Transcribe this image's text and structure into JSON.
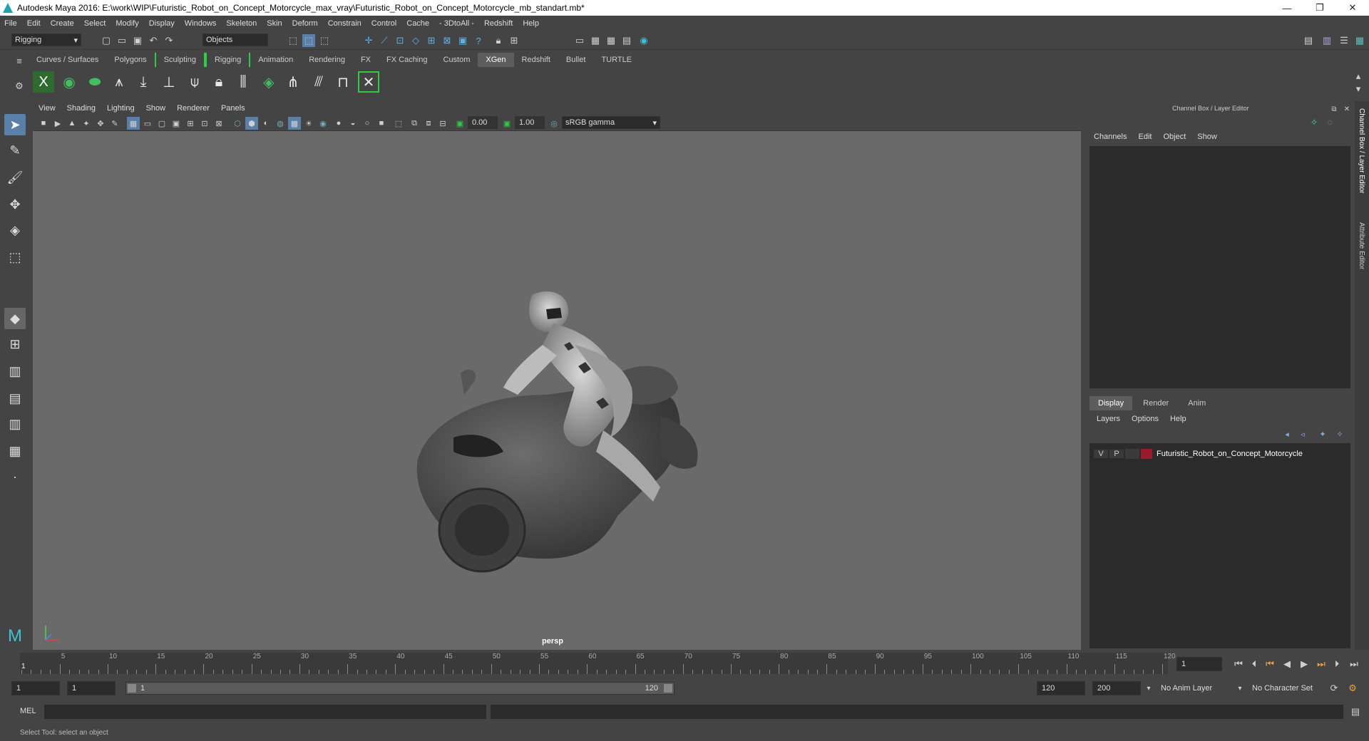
{
  "app": {
    "title": "Autodesk Maya 2016: E:\\work\\WIP\\Futuristic_Robot_on_Concept_Motorcycle_max_vray\\Futuristic_Robot_on_Concept_Motorcycle_mb_standart.mb*",
    "window_buttons": [
      "—",
      "❐",
      "✕"
    ]
  },
  "menubar": [
    "File",
    "Edit",
    "Create",
    "Select",
    "Modify",
    "Display",
    "Windows",
    "Skeleton",
    "Skin",
    "Deform",
    "Constrain",
    "Control",
    "Cache",
    "- 3DtoAll -",
    "Redshift",
    "Help"
  ],
  "statusline": {
    "menuset": "Rigging",
    "selection_mode": "Objects"
  },
  "shelf": {
    "tabs": [
      "Curves / Surfaces",
      "Polygons",
      "Sculpting",
      "Rigging",
      "Animation",
      "Rendering",
      "FX",
      "FX Caching",
      "Custom",
      "XGen",
      "Redshift",
      "Bullet",
      "TURTLE"
    ],
    "active_tab": "XGen"
  },
  "viewport": {
    "menu": [
      "View",
      "Shading",
      "Lighting",
      "Show",
      "Renderer",
      "Panels"
    ],
    "exposure": "0.00",
    "gamma": "1.00",
    "color_space": "sRGB gamma",
    "camera_label": "persp"
  },
  "channel_box": {
    "title": "Channel Box / Layer Editor",
    "menu": [
      "Channels",
      "Edit",
      "Object",
      "Show"
    ]
  },
  "layer_editor": {
    "tabs": [
      "Display",
      "Render",
      "Anim"
    ],
    "active_tab": "Display",
    "menu": [
      "Layers",
      "Options",
      "Help"
    ],
    "layers": [
      {
        "v": "V",
        "p": "P",
        "color": "#9b1b2e",
        "name": "Futuristic_Robot_on_Concept_Motorcycle"
      }
    ]
  },
  "side_tabs": [
    "Channel Box / Layer Editor",
    "Attribute Editor"
  ],
  "timeline": {
    "ticks": [
      "5",
      "10",
      "15",
      "20",
      "25",
      "30",
      "35",
      "40",
      "45",
      "50",
      "55",
      "60",
      "65",
      "70",
      "75",
      "80",
      "85",
      "90",
      "95",
      "100",
      "105",
      "110",
      "115",
      "120"
    ],
    "current_frame_marker": "1",
    "current_frame_field": "1"
  },
  "range": {
    "start": "1",
    "playback_start": "1",
    "slider_start": "1",
    "slider_end": "120",
    "playback_end": "120",
    "end": "200",
    "anim_layer": "No Anim Layer",
    "character_set": "No Character Set"
  },
  "command_line": {
    "label": "MEL"
  },
  "help_line": "Select Tool: select an object"
}
